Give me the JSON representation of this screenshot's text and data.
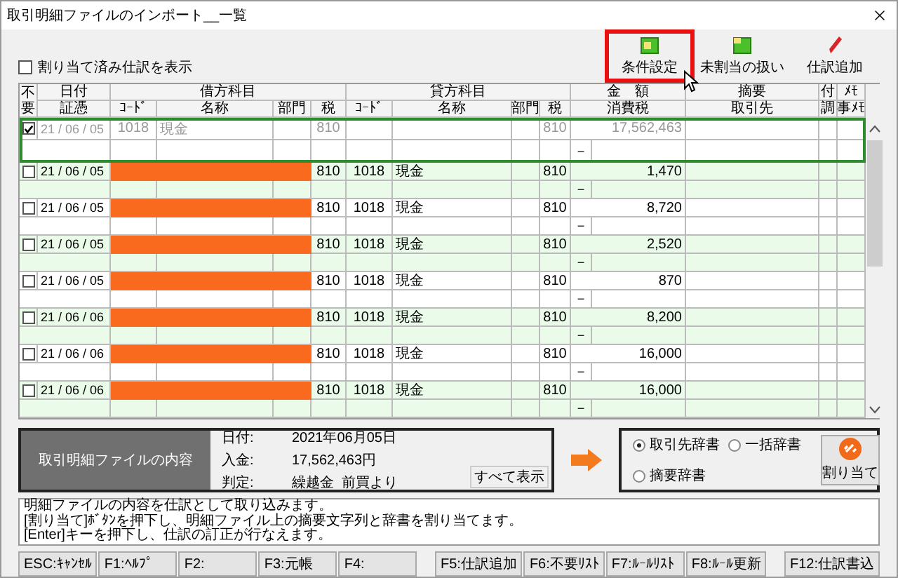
{
  "window": {
    "title": "取引明細ファイルのインポート__一覧"
  },
  "toolbar": {
    "show_assigned": {
      "label": "割り当て済み仕訳を表示",
      "checked": false
    },
    "buttons": [
      {
        "label": "条件設定",
        "kind": "settings",
        "highlighted": true
      },
      {
        "label": "未割当の扱い",
        "kind": "folder",
        "highlighted": false
      },
      {
        "label": "仕訳追加",
        "kind": "pencil",
        "highlighted": false
      }
    ]
  },
  "table": {
    "header_top": {
      "exclude": "不要",
      "date": "日付",
      "debit": "借方科目",
      "amount": "金　額",
      "summary": "摘要",
      "attach": "付",
      "memo": "ﾒﾓ"
    },
    "header_bottom": {
      "voucher": "証憑",
      "debit_code": "ｺｰﾄﾞ",
      "debit_name": "名称",
      "debit_dept": "部門",
      "debit_tax": "税",
      "credit_code": "ｺｰﾄﾞ",
      "credit_name": "名称",
      "credit_dept": "部門",
      "credit_tax": "税",
      "tax": "消費税",
      "partner": "取引先",
      "adjust": "調",
      "memo": "事ﾒﾓ"
    },
    "credit_title": "貸方科目",
    "rows": [
      {
        "excluded": true,
        "selected": true,
        "date": "21 / 06 / 05",
        "debit_unassigned": false,
        "debit_code": "1018",
        "debit_name": "現金",
        "debit_tax": "810",
        "credit_tax": "810",
        "amount": "17,562,463",
        "dash": "－"
      },
      {
        "excluded": false,
        "selected": false,
        "date": "21 / 06 / 05",
        "debit_unassigned": true,
        "debit_tax": "810",
        "credit_code": "1018",
        "credit_name": "現金",
        "credit_tax": "810",
        "amount": "1,470",
        "dash": "－"
      },
      {
        "excluded": false,
        "selected": false,
        "date": "21 / 06 / 05",
        "debit_unassigned": true,
        "debit_tax": "810",
        "credit_code": "1018",
        "credit_name": "現金",
        "credit_tax": "810",
        "amount": "8,720",
        "dash": "－"
      },
      {
        "excluded": false,
        "selected": false,
        "date": "21 / 06 / 05",
        "debit_unassigned": true,
        "debit_tax": "810",
        "credit_code": "1018",
        "credit_name": "現金",
        "credit_tax": "810",
        "amount": "2,520",
        "dash": "－"
      },
      {
        "excluded": false,
        "selected": false,
        "date": "21 / 06 / 05",
        "debit_unassigned": true,
        "debit_tax": "810",
        "credit_code": "1018",
        "credit_name": "現金",
        "credit_tax": "810",
        "amount": "870",
        "dash": "－"
      },
      {
        "excluded": false,
        "selected": false,
        "date": "21 / 06 / 06",
        "debit_unassigned": true,
        "debit_tax": "810",
        "credit_code": "1018",
        "credit_name": "現金",
        "credit_tax": "810",
        "amount": "8,200",
        "dash": "－"
      },
      {
        "excluded": false,
        "selected": false,
        "date": "21 / 06 / 06",
        "debit_unassigned": true,
        "debit_tax": "810",
        "credit_code": "1018",
        "credit_name": "現金",
        "credit_tax": "810",
        "amount": "16,000",
        "dash": "－"
      },
      {
        "excluded": false,
        "selected": false,
        "date": "21 / 06 / 06",
        "debit_unassigned": true,
        "debit_tax": "810",
        "credit_code": "1018",
        "credit_name": "現金",
        "credit_tax": "810",
        "amount": "16,000",
        "dash": "－"
      }
    ]
  },
  "summary": {
    "label": "取引明細ファイルの内容",
    "fields": [
      {
        "label": "日付:",
        "value": "2021年06月05日"
      },
      {
        "label": "入金:",
        "value": "17,562,463円"
      },
      {
        "label": "判定:",
        "value": "繰越金  前買より"
      }
    ],
    "show_all": "すべて表示"
  },
  "dictionaries": [
    {
      "label": "取引先辞書",
      "selected": true
    },
    {
      "label": "一括辞書",
      "selected": false
    },
    {
      "label": "摘要辞書",
      "selected": false
    }
  ],
  "assign_button": "割り当て",
  "message": [
    "明細ファイルの内容を仕訳として取り込みます。",
    "[割り当て]ﾎﾞﾀﾝを押下し、明細ファイル上の摘要文字列と辞書を割り当てます。",
    "[Enter]キーを押下し、仕訳の訂正が行なえます。"
  ],
  "function_keys": [
    [
      "ESC:ｷｬﾝｾﾙ",
      "F1:ﾍﾙﾌﾟ",
      "F2:",
      "F3:元帳",
      "F4:"
    ],
    [
      "F5:仕訳追加",
      "F6:不要ﾘｽﾄ",
      "F7:ﾙｰﾙﾘｽﾄ",
      "F8:ﾙｰﾙ更新"
    ],
    [
      "F12:仕訳書込"
    ]
  ]
}
